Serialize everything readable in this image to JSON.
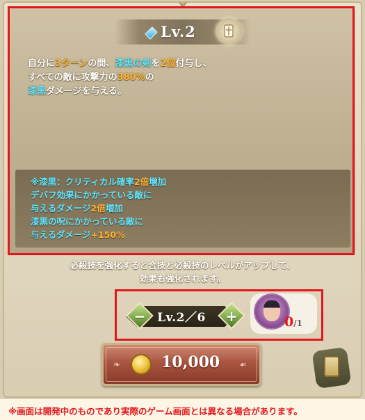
{
  "skill": {
    "level_label": "Lv.2",
    "description_lines": [
      [
        {
          "t": "自分に",
          "c": ""
        },
        {
          "t": "3ターン",
          "c": "c-org"
        },
        {
          "t": "の間、",
          "c": ""
        },
        {
          "t": "漆黒の剣",
          "c": "c-cyan"
        },
        {
          "t": "を",
          "c": ""
        },
        {
          "t": "2個",
          "c": "c-org"
        },
        {
          "t": "付与し、",
          "c": ""
        }
      ],
      [
        {
          "t": "すべての敵に攻撃力の",
          "c": ""
        },
        {
          "t": "380%",
          "c": "c-org"
        },
        {
          "t": "の",
          "c": ""
        }
      ],
      [
        {
          "t": "漆黒",
          "c": "c-cyan"
        },
        {
          "t": "ダメージを与える。",
          "c": ""
        }
      ]
    ],
    "note_lines": [
      [
        {
          "t": "※漆黒：クリティカル確率",
          "c": "c-cyan"
        },
        {
          "t": "2倍",
          "c": "c-org"
        },
        {
          "t": "増加",
          "c": "c-cyan"
        }
      ],
      [
        {
          "t": "デバフ効果にかかっている敵に",
          "c": "c-cyan"
        }
      ],
      [
        {
          "t": "与えるダメージ",
          "c": "c-cyan"
        },
        {
          "t": "2倍",
          "c": "c-org"
        },
        {
          "t": "増加",
          "c": "c-cyan"
        }
      ],
      [
        {
          "t": "漆黒の呪にかかっている敵に",
          "c": "c-cyan"
        }
      ],
      [
        {
          "t": "与えるダメージ",
          "c": "c-cyan"
        },
        {
          "t": "+150%",
          "c": "c-org"
        }
      ]
    ]
  },
  "enhance": {
    "subtitle_line1": "必殺技を強化すると合技と必殺技のレベルがアップして、",
    "subtitle_line2": "効果も強化されます。",
    "level_display": "Lv.2／6",
    "decrease_symbol": "−",
    "increase_symbol": "+",
    "material_have": "0",
    "material_need": "/1"
  },
  "cost": {
    "amount": "10,000"
  },
  "disclaimer": "※画面は開発中のものであり実際のゲーム画面とは異なる場合があります。",
  "colors": {
    "highlight": "#e3161b",
    "accent_orange": "#ffb330",
    "accent_cyan": "#5fe6ff"
  },
  "icons": {
    "skill": "skill-emblem-icon",
    "gem": "blue-gem-icon",
    "coin": "gold-coin-icon",
    "cards": "card-deck-icon",
    "material": "character-material-icon"
  }
}
